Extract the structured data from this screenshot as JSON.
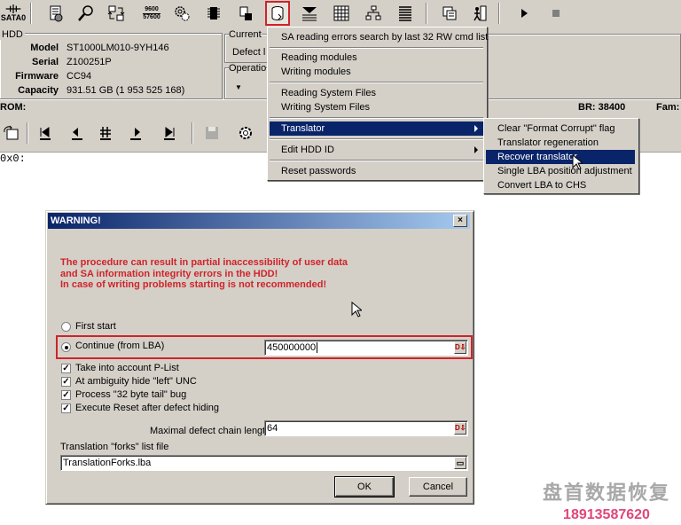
{
  "toolbar": {
    "sata_label": "SATA0",
    "speed_label_top": "9600",
    "speed_label_bottom": "57600",
    "icons": [
      "port-icon",
      "drive-icon",
      "search-icon",
      "transfer-icon",
      "speed-icon",
      "gears-icon",
      "chip-icon",
      "module-icon",
      "sa-database-icon",
      "translator-icon",
      "grid-icon",
      "tree-icon",
      "list-icon",
      "copy-icon",
      "exit-icon",
      "play-icon",
      "stop-icon"
    ]
  },
  "hdd": {
    "group_label": "HDD",
    "model_label": "Model",
    "model": "ST1000LM010-9YH146",
    "serial_label": "Serial",
    "serial": "Z100251P",
    "firmware_label": "Firmware",
    "firmware": "CC94",
    "capacity_label": "Capacity",
    "capacity": "931.51 GB (1 953 525 168)"
  },
  "right_panel": {
    "current_label": "Current",
    "defect_label": "Defect l",
    "operation_label": "Operatio"
  },
  "status": {
    "rom_label": "ROM:",
    "br": "BR: 38400",
    "fam": "Fam:"
  },
  "console": {
    "line": "0x0:"
  },
  "menu": {
    "items": [
      "SA reading errors search by last 32 RW cmd list",
      "Reading modules",
      "Writing modules",
      "Reading System Files",
      "Writing System Files",
      "Translator",
      "Edit HDD ID",
      "Reset passwords"
    ]
  },
  "submenu": {
    "items": [
      "Clear \"Format Corrupt\" flag",
      "Translator regeneration",
      "Recover translator",
      "Single LBA position adjustment",
      "Convert LBA to CHS"
    ]
  },
  "dialog": {
    "title": "WARNING!",
    "close": "×",
    "warning_lines": [
      "The procedure can result in partial inaccessibility of user data",
      "and SA information integrity errors in the HDD!",
      "In case of writing problems starting is not recommended!"
    ],
    "first_start": "First start",
    "continue_label": "Continue (from LBA)",
    "lba_value": "450000000",
    "checks": [
      {
        "label": "Take into account P-List",
        "checked": true
      },
      {
        "label": "At ambiguity hide \"left\" UNC",
        "checked": true
      },
      {
        "label": "Process \"32 byte tail\" bug",
        "checked": true
      },
      {
        "label": "Execute Reset after defect hiding",
        "checked": true
      }
    ],
    "chain_label": "Maximal defect chain length",
    "chain_value": "64",
    "forks_label": "Translation \"forks\" list file",
    "forks_value": "TranslationForks.lba",
    "ok": "OK",
    "cancel": "Cancel",
    "check_mark": "✓"
  },
  "watermark": {
    "line1": "盘首数据恢复",
    "line2": "18913587620"
  },
  "colors": {
    "accent": "#d0232a",
    "highlight": "#0a246a",
    "face": "#d4d0c8"
  }
}
